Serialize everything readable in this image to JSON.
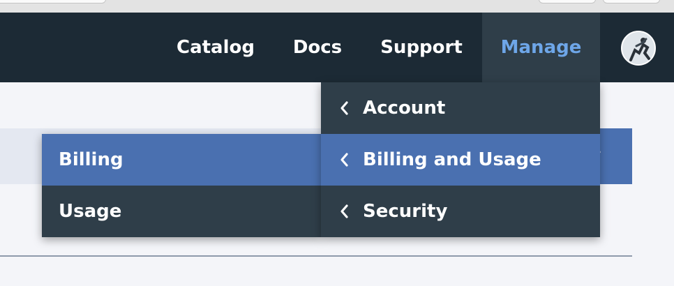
{
  "header": {
    "nav": [
      {
        "label": "Catalog"
      },
      {
        "label": "Docs"
      },
      {
        "label": "Support"
      },
      {
        "label": "Manage"
      }
    ]
  },
  "manage_menu": {
    "items": [
      {
        "label": "Account"
      },
      {
        "label": "Billing and Usage"
      },
      {
        "label": "Security"
      }
    ]
  },
  "submenu": {
    "items": [
      {
        "label": "Billing"
      },
      {
        "label": "Usage"
      }
    ]
  },
  "background": {
    "partial_text": "r"
  },
  "colors": {
    "header_bg": "#1c2a35",
    "menu_bg": "#2f3e49",
    "selected_bg": "#4a70b0",
    "active_nav_text": "#6ea6e8"
  },
  "icons": {
    "chevron": "chevron-left-icon",
    "avatar": "user-avatar"
  }
}
